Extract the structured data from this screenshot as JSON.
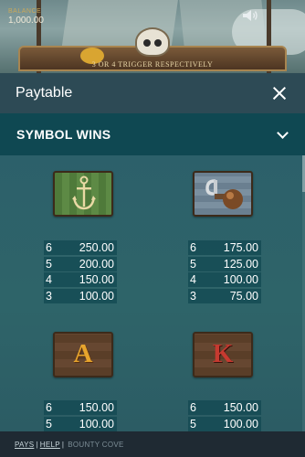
{
  "game": {
    "balance_label": "BALANCE",
    "balance_value": "1,000.00",
    "banner_text": "3 OR 4 TRIGGER RESPECTIVELY",
    "sound_icon": "speaker-icon"
  },
  "paytable": {
    "title": "Paytable",
    "close_icon": "close-icon",
    "section": {
      "label": "SYMBOL WINS",
      "icon": "chevron-down-icon"
    },
    "symbols": [
      {
        "name": "anchor",
        "icon": "anchor-icon",
        "pays": [
          {
            "count": "6",
            "amount": "250.00"
          },
          {
            "count": "5",
            "amount": "200.00"
          },
          {
            "count": "4",
            "amount": "150.00"
          },
          {
            "count": "3",
            "amount": "100.00"
          }
        ]
      },
      {
        "name": "hook",
        "icon": "hook-icon",
        "pays": [
          {
            "count": "6",
            "amount": "175.00"
          },
          {
            "count": "5",
            "amount": "125.00"
          },
          {
            "count": "4",
            "amount": "100.00"
          },
          {
            "count": "3",
            "amount": "75.00"
          }
        ]
      },
      {
        "name": "letter-a",
        "glyph": "A",
        "pays": [
          {
            "count": "6",
            "amount": "150.00"
          },
          {
            "count": "5",
            "amount": "100.00"
          }
        ]
      },
      {
        "name": "letter-k",
        "glyph": "K",
        "pays": [
          {
            "count": "6",
            "amount": "150.00"
          },
          {
            "count": "5",
            "amount": "100.00"
          }
        ]
      }
    ]
  },
  "footer": {
    "pays_link": "PAYS",
    "separator": "|",
    "help_link": "HELP",
    "game_name": "BOUNTY COVE"
  },
  "colors": {
    "overlay_header": "#2d4a55",
    "section_header": "#0f4852",
    "content_bg": "#2c5f6a",
    "pay_row_bg": "#114852",
    "footer_bg": "#1f2a33"
  }
}
